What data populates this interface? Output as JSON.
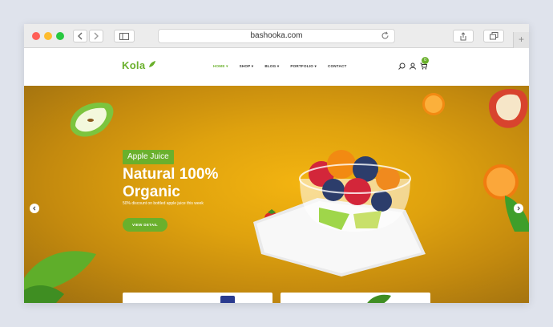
{
  "browser": {
    "url": "bashooka.com",
    "new_tab_label": "+"
  },
  "site": {
    "logo": "Kola",
    "nav": [
      {
        "label": "HOME",
        "active": true,
        "dropdown": true
      },
      {
        "label": "SHOP",
        "active": false,
        "dropdown": true
      },
      {
        "label": "BLOG",
        "active": false,
        "dropdown": true
      },
      {
        "label": "PORTFOLIO",
        "active": false,
        "dropdown": true
      },
      {
        "label": "CONTACT",
        "active": false,
        "dropdown": false
      }
    ],
    "cart_count": "0"
  },
  "hero": {
    "badge": "Apple Juice",
    "title": "Natural 100% Organic",
    "subtitle": "50% discount on bottled apple juice this week",
    "button": "VIEW DETAIL"
  },
  "colors": {
    "accent": "#6ab02c",
    "hero_bg": "#dfa20e"
  },
  "icons": [
    "back-icon",
    "forward-icon",
    "sidebar-icon",
    "reload-icon",
    "share-icon",
    "tabs-icon",
    "search-icon",
    "user-icon",
    "cart-icon",
    "leaf-icon",
    "chevron-left-icon",
    "chevron-right-icon"
  ]
}
